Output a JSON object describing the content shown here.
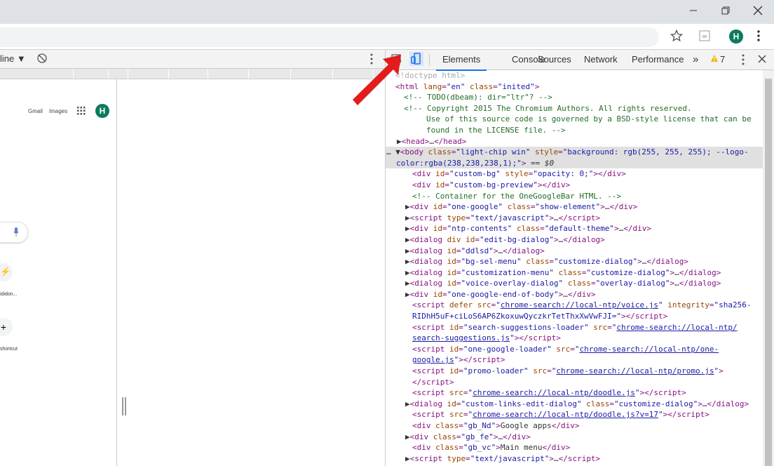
{
  "browser": {
    "minimize_icon": "minimize",
    "restore_icon": "restore",
    "close_icon": "close",
    "star_icon": "star",
    "ext_icon": "extension",
    "avatar_letter": "H",
    "menu_icon": "more-vert"
  },
  "device_toolbar": {
    "throttle": "line",
    "rotate_icon": "rotate"
  },
  "page_preview": {
    "gmail": "Gmail",
    "images": "Images",
    "avatar_letter": "H",
    "shortcut1": "ididon...",
    "shortcut2": "shortcut",
    "plus": "+"
  },
  "devtools": {
    "tabs": [
      "Elements",
      "Console",
      "Sources",
      "Network",
      "Performance"
    ],
    "more_tabs": "»",
    "warning_count": "7",
    "eq0": "== $0"
  }
}
